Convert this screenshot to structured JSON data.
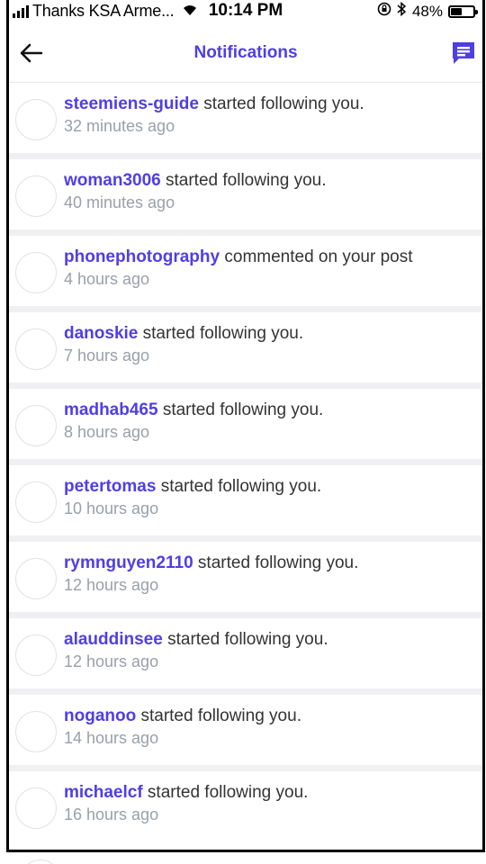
{
  "status_bar": {
    "carrier": "Thanks KSA Arme...",
    "time": "10:14 PM",
    "battery_percent": "48%",
    "battery_level": 0.48
  },
  "header": {
    "title": "Notifications"
  },
  "notifications": [
    {
      "user": "steemiens-guide",
      "action": " started following you.",
      "time": "32 minutes ago"
    },
    {
      "user": "woman3006",
      "action": " started following you.",
      "time": "40 minutes ago"
    },
    {
      "user": "phonephotography",
      "action": " commented on your post",
      "time": "4 hours ago"
    },
    {
      "user": "danoskie",
      "action": " started following you.",
      "time": "7 hours ago"
    },
    {
      "user": "madhab465",
      "action": " started following you.",
      "time": "8 hours ago"
    },
    {
      "user": "petertomas",
      "action": " started following you.",
      "time": "10 hours ago"
    },
    {
      "user": "rymnguyen2110",
      "action": " started following you.",
      "time": "12 hours ago"
    },
    {
      "user": "alauddinsee",
      "action": " started following you.",
      "time": "12 hours ago"
    },
    {
      "user": "noganoo",
      "action": " started following you.",
      "time": "14 hours ago"
    },
    {
      "user": "michaelcf",
      "action": " started following you.",
      "time": "16 hours ago"
    }
  ],
  "colors": {
    "accent": "#4f3ee6",
    "secondary_text": "#9aa0a8"
  }
}
